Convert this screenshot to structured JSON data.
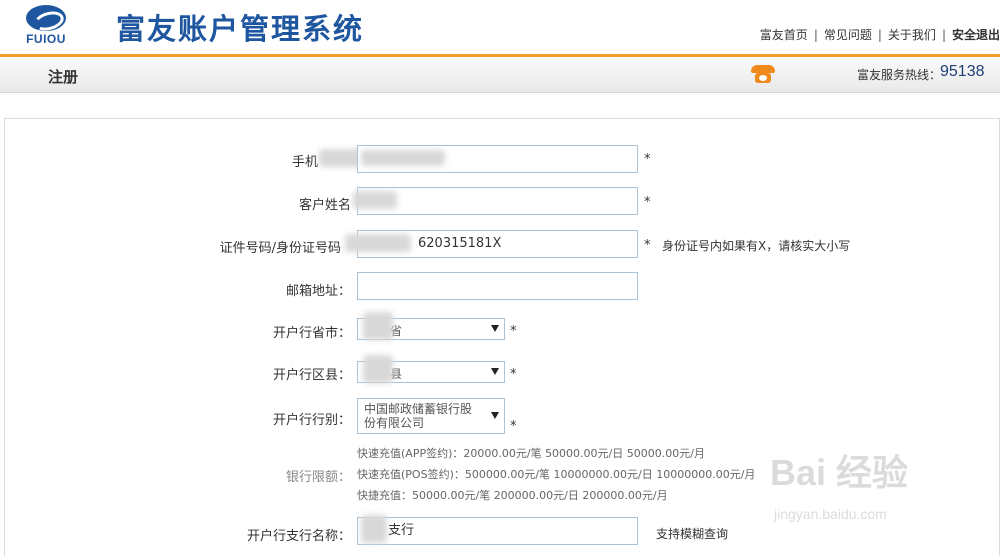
{
  "header": {
    "logo_text": "FUIOU",
    "site_title": "富友账户管理系统",
    "nav": [
      "富友首页",
      "常见问题",
      "关于我们",
      "安全退出"
    ]
  },
  "page_bar": {
    "title": "注册",
    "hotline_label": "富友服务热线：",
    "hotline_number": "95138"
  },
  "form": {
    "phone": {
      "label": "手机",
      "value": ""
    },
    "name": {
      "label": "客户姓名",
      "value": ""
    },
    "id_number": {
      "label": "证件号码/身份证号码",
      "value": "620315181X",
      "hint": "身份证号内如果有X，请核实大小写"
    },
    "email": {
      "label": "邮箱地址：",
      "value": ""
    },
    "province": {
      "label": "开户行省市：",
      "selected": "省"
    },
    "district": {
      "label": "开户行区县：",
      "selected": "县"
    },
    "bank_type": {
      "label": "开户行行别：",
      "selected": "中国邮政储蓄银行股份有限公司"
    },
    "bank_limit": {
      "label": "银行限额：",
      "lines": [
        "快速充值(APP签约)：20000.00元/笔  50000.00元/日  50000.00元/月",
        "快速充值(POS签约)：500000.00元/笔  10000000.00元/日  10000000.00元/月",
        "快捷充值：50000.00元/笔  200000.00元/日  200000.00元/月"
      ]
    },
    "branch": {
      "label": "开户行支行名称：",
      "value": "支行",
      "hint": "支持模糊查询"
    },
    "required_mark": "*"
  },
  "watermark": {
    "main": "Bai 经验",
    "sub": "jingyan.baidu.com"
  },
  "colors": {
    "brand_blue": "#1f56a0",
    "accent_orange": "#f39a2b",
    "input_border": "#a9c3d9"
  }
}
